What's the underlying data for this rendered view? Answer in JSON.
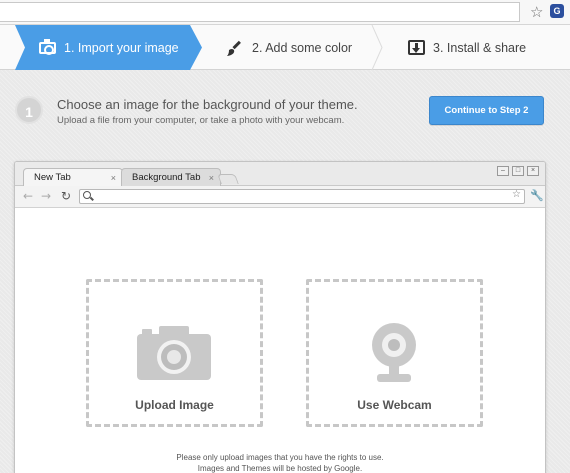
{
  "steps": [
    {
      "label": "1. Import your image"
    },
    {
      "label": "2. Add some color"
    },
    {
      "label": "3. Install & share"
    }
  ],
  "instruction": {
    "number": "1",
    "headline": "Choose an image for the background of your theme.",
    "subline": "Upload a file from your computer, or take a photo with your webcam."
  },
  "continue_button": "Continue to Step 2",
  "mock_browser": {
    "tabs": [
      {
        "label": "New Tab",
        "close": "×"
      },
      {
        "label": "Background Tab",
        "close": "×"
      }
    ],
    "window_controls": [
      "–",
      "□",
      "×"
    ]
  },
  "options": {
    "upload_label": "Upload Image",
    "webcam_label": "Use Webcam"
  },
  "footer": {
    "line1": "Please only upload images that you have the rights to use.",
    "line2": "Images and Themes will be hosted by Google."
  },
  "colors": {
    "accent": "#4a9de6",
    "background": "#e9e9e9",
    "icon_gray": "#c7c7c7"
  }
}
